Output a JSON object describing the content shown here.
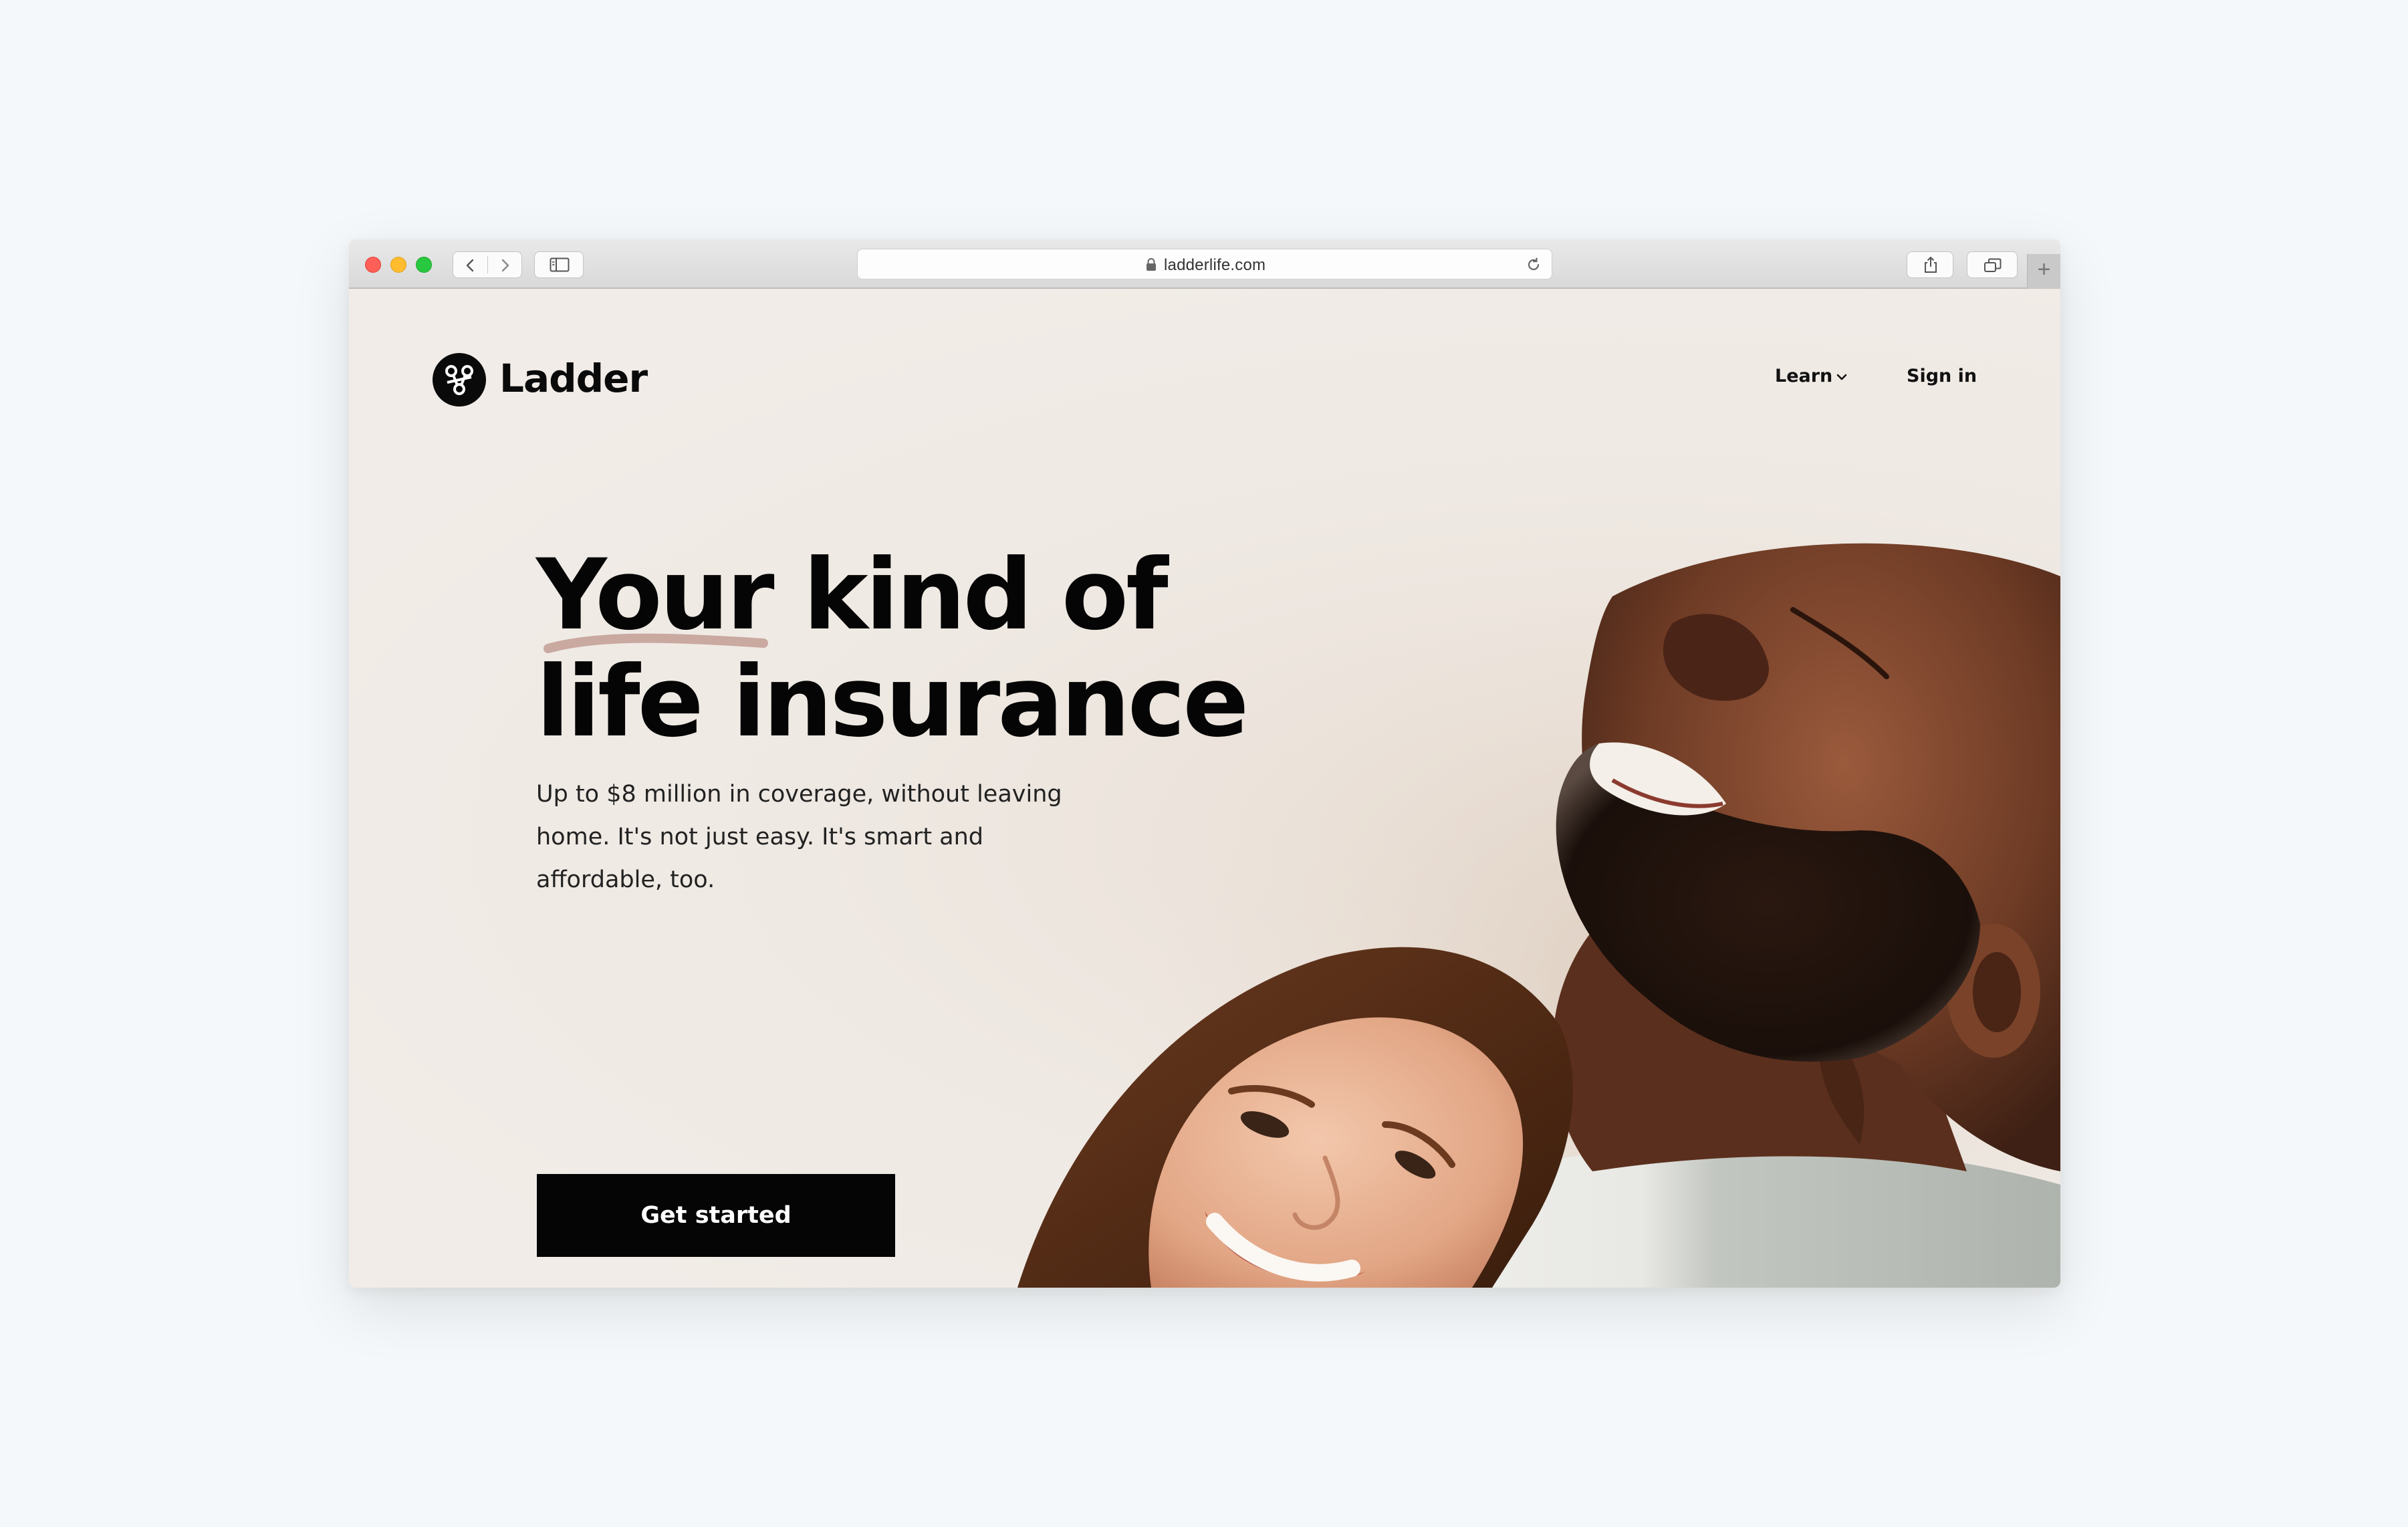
{
  "browser": {
    "url": "ladderlife.com"
  },
  "site": {
    "brand": "Ladder",
    "nav": {
      "learn_label": "Learn",
      "signin_label": "Sign in"
    }
  },
  "hero": {
    "headline_word1": "Your",
    "headline_rest1": " kind of",
    "headline_line2": "life insurance",
    "subtext": "Up to $8 million in coverage, without leaving home. It's not just easy. It's smart and affordable, too.",
    "cta_label": "Get started"
  },
  "colors": {
    "page_background": "#f1ece7",
    "cta_background": "#050505",
    "swash": "#c9a9a0"
  }
}
